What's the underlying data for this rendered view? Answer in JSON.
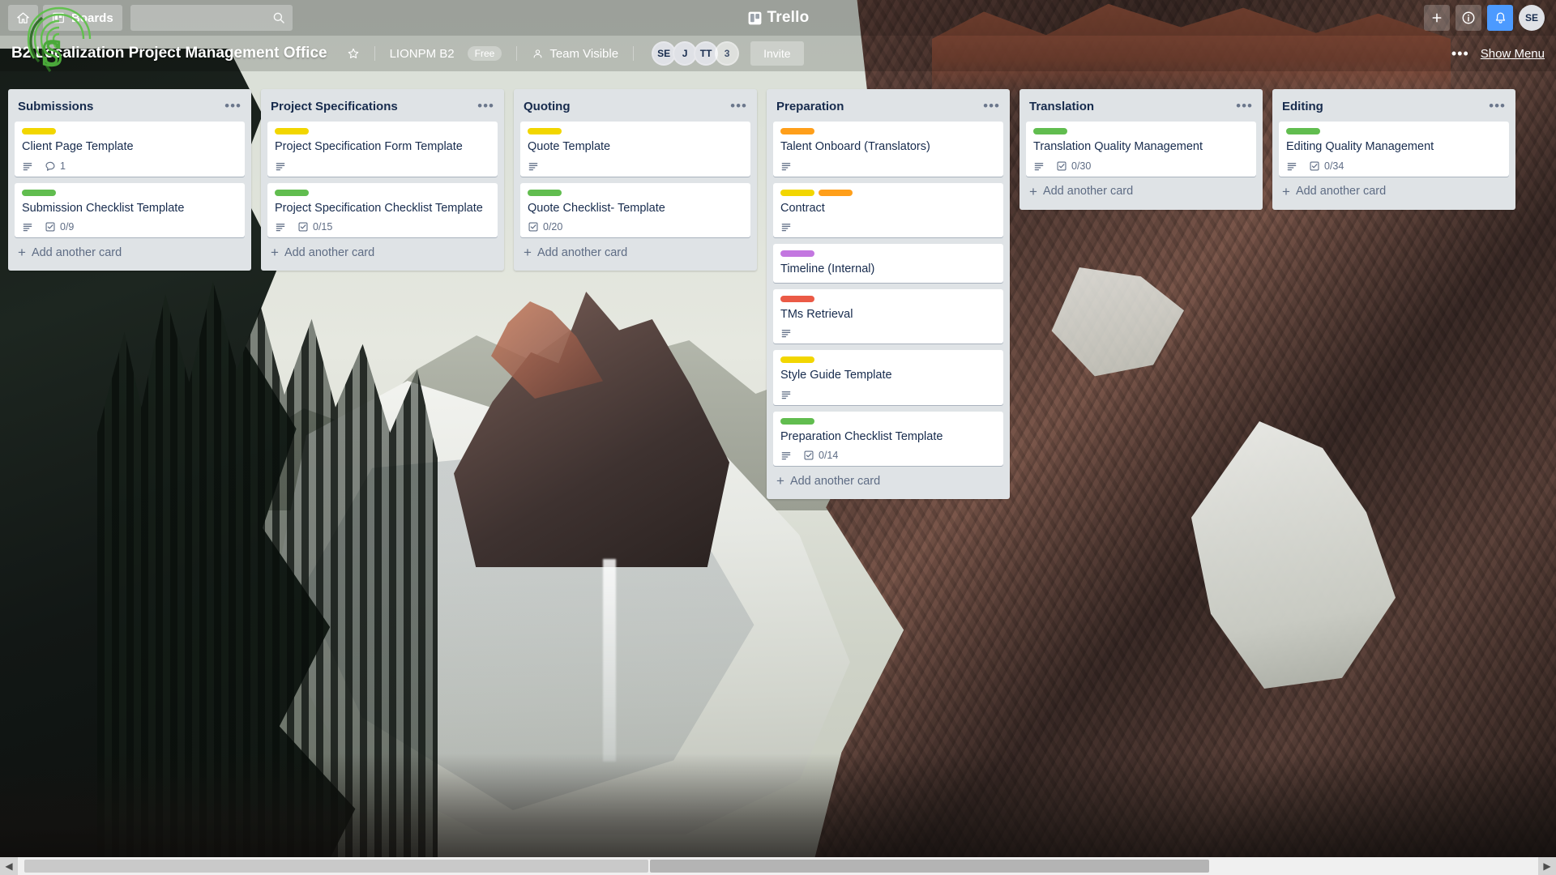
{
  "topnav": {
    "home_icon": "home-icon",
    "boards_label": "Boards",
    "boards_icon": "boards-icon",
    "search_placeholder": "",
    "search_value": "",
    "search_icon": "search-icon",
    "brand": "Trello",
    "brand_icon": "trello-logo-icon",
    "add_icon": "plus-icon",
    "info_icon": "info-icon",
    "notifications_icon": "bell-icon",
    "avatar_initials": "SE"
  },
  "boardbar": {
    "title": "B2 Localization Project Management Office",
    "star_icon": "star-icon",
    "team_name": "LIONPM B2",
    "plan_badge": "Free",
    "visibility_icon": "team-visible-icon",
    "visibility": "Team Visible",
    "members": [
      {
        "initials": "SE",
        "type": "avatar"
      },
      {
        "initials": "J",
        "type": "avatar"
      },
      {
        "initials": "TT",
        "type": "avatar"
      },
      {
        "initials": "3",
        "type": "counter"
      }
    ],
    "invite_label": "Invite",
    "more_icon": "more-dots-icon",
    "show_menu_label": "Show Menu"
  },
  "colors": {
    "label_yellow": "#f2d600",
    "label_green": "#61bd4f",
    "label_orange": "#ff9f1a",
    "label_purple": "#c377e0",
    "label_red": "#eb5a46",
    "list_bg": "#dfe3e6",
    "card_bg": "#ffffff",
    "text_dark": "#172b4d",
    "text_muted": "#5e6c84",
    "accent_blue": "#4c9aff"
  },
  "lists": [
    {
      "title": "Submissions",
      "menu_icon": "list-menu-icon",
      "add_card_label": "Add another card",
      "cards": [
        {
          "title": "Client Page Template",
          "labels": [
            "#f2d600"
          ],
          "badges": [
            {
              "type": "description",
              "icon": "description-icon",
              "text": ""
            },
            {
              "type": "comments",
              "icon": "comment-icon",
              "text": "1"
            }
          ]
        },
        {
          "title": "Submission Checklist Template",
          "labels": [
            "#61bd4f"
          ],
          "badges": [
            {
              "type": "description",
              "icon": "description-icon",
              "text": ""
            },
            {
              "type": "checklist",
              "icon": "checklist-icon",
              "text": "0/9"
            }
          ]
        }
      ]
    },
    {
      "title": "Project Specifications",
      "menu_icon": "list-menu-icon",
      "add_card_label": "Add another card",
      "cards": [
        {
          "title": "Project Specification Form Template",
          "labels": [
            "#f2d600"
          ],
          "badges": [
            {
              "type": "description",
              "icon": "description-icon",
              "text": ""
            }
          ]
        },
        {
          "title": "Project Specification Checklist Template",
          "labels": [
            "#61bd4f"
          ],
          "badges": [
            {
              "type": "description",
              "icon": "description-icon",
              "text": ""
            },
            {
              "type": "checklist",
              "icon": "checklist-icon",
              "text": "0/15"
            }
          ]
        }
      ]
    },
    {
      "title": "Quoting",
      "menu_icon": "list-menu-icon",
      "add_card_label": "Add another card",
      "cards": [
        {
          "title": "Quote Template",
          "labels": [
            "#f2d600"
          ],
          "badges": [
            {
              "type": "description",
              "icon": "description-icon",
              "text": ""
            }
          ]
        },
        {
          "title": "Quote Checklist- Template",
          "labels": [
            "#61bd4f"
          ],
          "badges": [
            {
              "type": "checklist",
              "icon": "checklist-icon",
              "text": "0/20"
            }
          ]
        }
      ]
    },
    {
      "title": "Preparation",
      "menu_icon": "list-menu-icon",
      "add_card_label": "Add another card",
      "cards": [
        {
          "title": "Talent Onboard (Translators)",
          "labels": [
            "#ff9f1a"
          ],
          "badges": [
            {
              "type": "description",
              "icon": "description-icon",
              "text": ""
            }
          ]
        },
        {
          "title": "Contract",
          "labels": [
            "#f2d600",
            "#ff9f1a"
          ],
          "badges": [
            {
              "type": "description",
              "icon": "description-icon",
              "text": ""
            }
          ]
        },
        {
          "title": "Timeline (Internal)",
          "labels": [
            "#c377e0"
          ],
          "badges": []
        },
        {
          "title": "TMs Retrieval",
          "labels": [
            "#eb5a46"
          ],
          "badges": [
            {
              "type": "description",
              "icon": "description-icon",
              "text": ""
            }
          ]
        },
        {
          "title": "Style Guide Template",
          "labels": [
            "#f2d600"
          ],
          "badges": [
            {
              "type": "description",
              "icon": "description-icon",
              "text": ""
            }
          ]
        },
        {
          "title": "Preparation Checklist Template",
          "labels": [
            "#61bd4f"
          ],
          "badges": [
            {
              "type": "description",
              "icon": "description-icon",
              "text": ""
            },
            {
              "type": "checklist",
              "icon": "checklist-icon",
              "text": "0/14"
            }
          ]
        }
      ]
    },
    {
      "title": "Translation",
      "menu_icon": "list-menu-icon",
      "add_card_label": "Add another card",
      "cards": [
        {
          "title": "Translation Quality Management",
          "labels": [
            "#61bd4f"
          ],
          "badges": [
            {
              "type": "description",
              "icon": "description-icon",
              "text": ""
            },
            {
              "type": "checklist",
              "icon": "checklist-icon",
              "text": "0/30"
            }
          ]
        }
      ]
    },
    {
      "title": "Editing",
      "menu_icon": "list-menu-icon",
      "add_card_label": "Add another card",
      "cards": [
        {
          "title": "Editing Quality Management",
          "labels": [
            "#61bd4f"
          ],
          "badges": [
            {
              "type": "description",
              "icon": "description-icon",
              "text": ""
            },
            {
              "type": "checklist",
              "icon": "checklist-icon",
              "text": "0/34"
            }
          ]
        }
      ]
    }
  ],
  "scrollbar": {
    "left_arrow": "scroll-left-arrow",
    "right_arrow": "scroll-right-arrow"
  }
}
